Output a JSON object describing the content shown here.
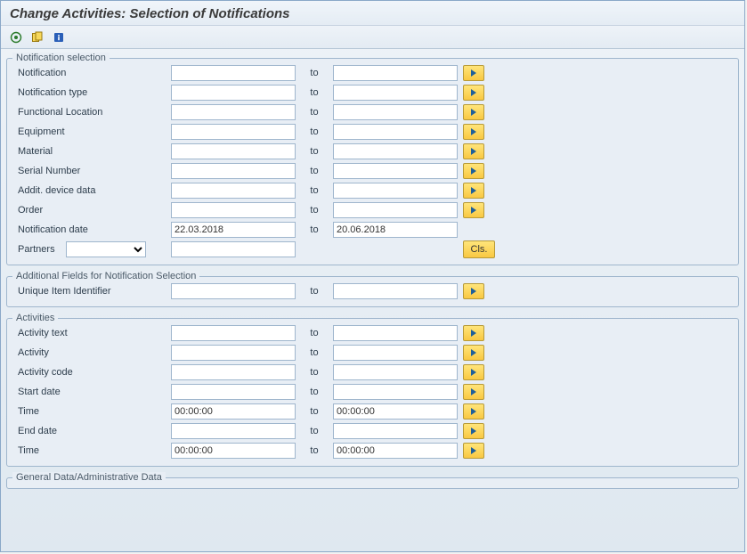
{
  "title": "Change Activities: Selection of Notifications",
  "toolbar": {
    "execute_icon": "execute",
    "variant_icon": "variant",
    "info_icon": "info"
  },
  "groups": {
    "notif": {
      "legend": "Notification selection",
      "rows": {
        "notification": {
          "label": "Notification",
          "from": "",
          "to_label": "to",
          "to": ""
        },
        "notif_type": {
          "label": "Notification type",
          "from": "",
          "to_label": "to",
          "to": ""
        },
        "funcloc": {
          "label": "Functional Location",
          "from": "",
          "to_label": "to",
          "to": ""
        },
        "equipment": {
          "label": "Equipment",
          "from": "",
          "to_label": "to",
          "to": ""
        },
        "material": {
          "label": "Material",
          "from": "",
          "to_label": "to",
          "to": ""
        },
        "serial": {
          "label": "Serial Number",
          "from": "",
          "to_label": "to",
          "to": ""
        },
        "addit": {
          "label": "Addit. device data",
          "from": "",
          "to_label": "to",
          "to": ""
        },
        "order": {
          "label": "Order",
          "from": "",
          "to_label": "to",
          "to": ""
        },
        "notif_date": {
          "label": "Notification date",
          "from": "22.03.2018",
          "to_label": "to",
          "to": "20.06.2018"
        },
        "partners": {
          "label": "Partners",
          "selected": "",
          "value": "",
          "cls_label": "Cls."
        }
      }
    },
    "addfields": {
      "legend": "Additional Fields for Notification Selection",
      "rows": {
        "uii": {
          "label": "Unique Item Identifier",
          "from": "",
          "to_label": "to",
          "to": ""
        }
      }
    },
    "activities": {
      "legend": "Activities",
      "rows": {
        "act_text": {
          "label": "Activity text",
          "from": "",
          "to_label": "to",
          "to": ""
        },
        "activity": {
          "label": "Activity",
          "from": "",
          "to_label": "to",
          "to": ""
        },
        "act_code": {
          "label": "Activity code",
          "from": "",
          "to_label": "to",
          "to": ""
        },
        "startdate": {
          "label": "Start date",
          "from": "",
          "to_label": "to",
          "to": ""
        },
        "time1": {
          "label": "Time",
          "from": "00:00:00",
          "to_label": "to",
          "to": "00:00:00"
        },
        "enddate": {
          "label": "End date",
          "from": "",
          "to_label": "to",
          "to": ""
        },
        "time2": {
          "label": "Time",
          "from": "00:00:00",
          "to_label": "to",
          "to": "00:00:00"
        }
      }
    },
    "general": {
      "legend": "General Data/Administrative Data"
    }
  }
}
